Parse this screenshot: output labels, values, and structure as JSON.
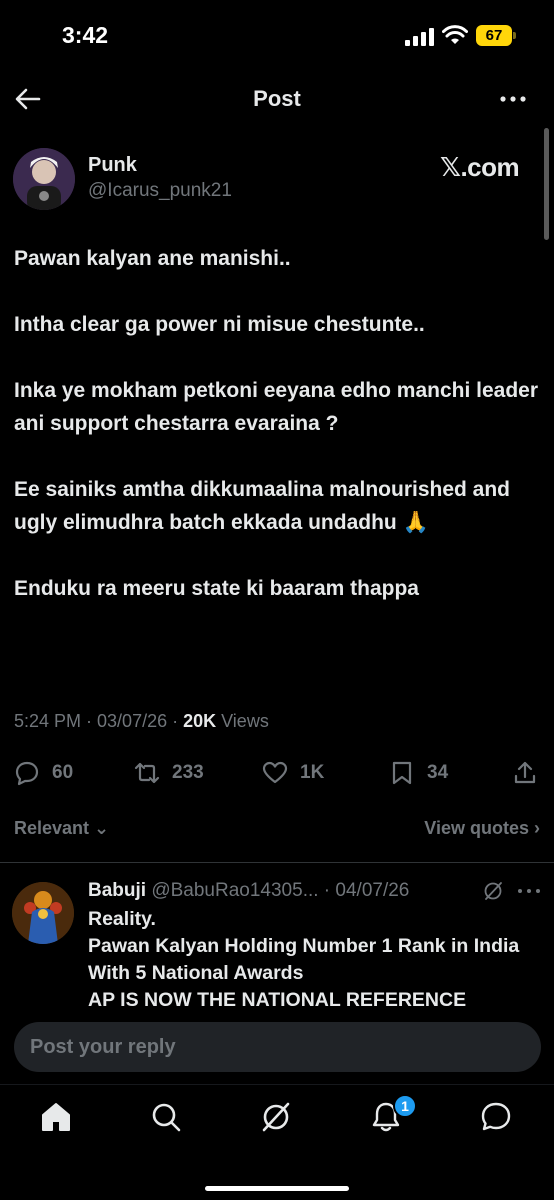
{
  "status_bar": {
    "time": "3:42",
    "battery": "67",
    "battery_color": "#ffd60a"
  },
  "header": {
    "title": "Post",
    "back_icon": "arrow-left-icon",
    "more_icon": "more-horizontal-icon"
  },
  "post": {
    "author_name": "Punk",
    "author_handle": "@Icarus_punk21",
    "watermark": "𝕏.com",
    "paragraphs": [
      "Pawan kalyan ane manishi..",
      "Intha clear ga power ni misue chestunte..",
      "Inka ye mokham petkoni eeyana edho manchi leader ani support chestarra evaraina ?",
      "Ee sainiks amtha dikkumaalina malnourished and ugly elimudhra batch ekkada undadhu 🙏",
      "Enduku ra meeru state ki baaram thappa"
    ],
    "meta_time": "5:24 PM · 03/07/26 · ",
    "meta_views_count": "20K",
    "meta_views_label": " Views",
    "actions": {
      "replies": "60",
      "reposts": "233",
      "likes": "1K",
      "bookmarks": "34"
    }
  },
  "sort": {
    "relevant_label": "Relevant ⌄",
    "view_quotes_label": "View quotes ›"
  },
  "reply": {
    "name": "Babuji",
    "handle_date": " @BabuRao14305... · 04/07/26",
    "lines": [
      "Reality.",
      "Pawan Kalyan Holding Number 1 Rank in India With 5 National Awards",
      "AP IS NOW THE NATIONAL REFERENCE"
    ]
  },
  "composer": {
    "placeholder": "Post your reply"
  },
  "tabbar": {
    "items": [
      "home-icon",
      "search-icon",
      "grok-icon",
      "notifications-icon",
      "messages-icon"
    ],
    "notification_badge": "1",
    "accent": "#1d9bf0"
  }
}
